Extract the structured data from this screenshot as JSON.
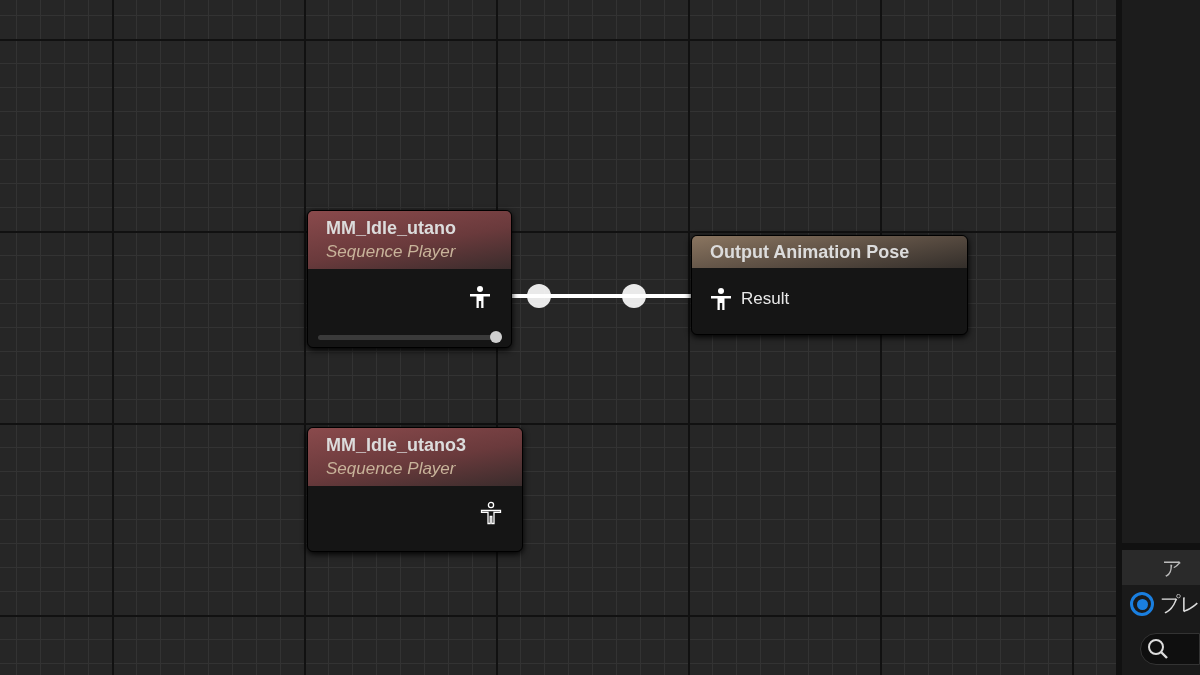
{
  "graph": {
    "nodes": [
      {
        "kind": "sequence",
        "title": "MM_Idle_utano",
        "subtitle": "Sequence Player",
        "pin_connected": true,
        "level": 1.0
      },
      {
        "kind": "output",
        "title": "Output Animation Pose",
        "pin_label": "Result",
        "pin_connected": true
      },
      {
        "kind": "sequence",
        "title": "MM_Idle_utano3",
        "subtitle": "Sequence Player",
        "pin_connected": false
      }
    ]
  },
  "side_panel": {
    "section_title": "ア",
    "radio": {
      "label": "プレ",
      "selected": true
    }
  }
}
